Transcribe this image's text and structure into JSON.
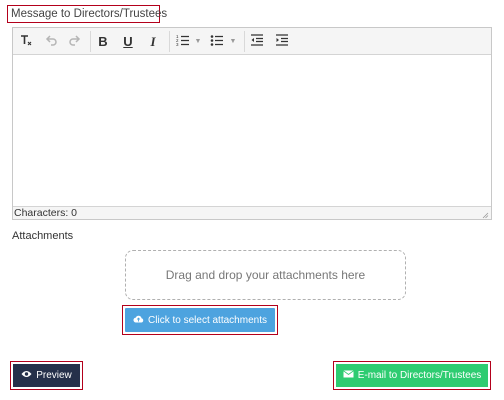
{
  "message": {
    "label": "Message to Directors/Trustees",
    "characters_label": "Characters: 0"
  },
  "toolbar": {
    "buttons": [
      {
        "icon": "clear-format-icon",
        "glyph": "Tx"
      },
      {
        "icon": "undo-icon",
        "glyph": "↶"
      },
      {
        "icon": "redo-icon",
        "glyph": "↷"
      },
      {
        "icon": "bold-icon",
        "glyph": "B"
      },
      {
        "icon": "underline-icon",
        "glyph": "U"
      },
      {
        "icon": "italic-icon",
        "glyph": "I"
      },
      {
        "icon": "ordered-list-icon",
        "glyph": "≡"
      },
      {
        "icon": "unordered-list-icon",
        "glyph": "≡"
      },
      {
        "icon": "outdent-icon",
        "glyph": "⇤"
      },
      {
        "icon": "indent-icon",
        "glyph": "⇥"
      }
    ]
  },
  "attachments": {
    "label": "Attachments",
    "dropzone_text": "Drag and drop your attachments here",
    "select_button": "Click to select attachments"
  },
  "actions": {
    "preview": "Preview",
    "email": "E-mail to Directors/Trustees"
  },
  "colors": {
    "highlight_border": "#b3001b",
    "select_button": "#4da3df",
    "preview_button": "#25304a",
    "email_button": "#2ecc71"
  }
}
